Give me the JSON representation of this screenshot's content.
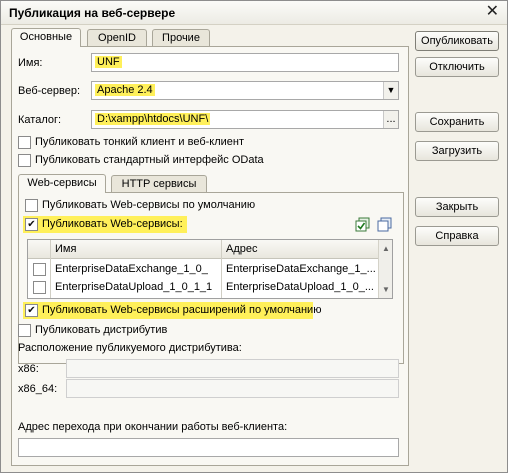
{
  "window": {
    "title": "Публикация на веб-сервере",
    "close_glyph": "✕"
  },
  "tabs": [
    {
      "label": "Основные"
    },
    {
      "label": "OpenID"
    },
    {
      "label": "Прочие"
    }
  ],
  "form": {
    "name_label": "Имя:",
    "name_value": "UNF",
    "webserver_label": "Веб-сервер:",
    "webserver_value": "Apache 2.4",
    "catalog_label": "Каталог:",
    "catalog_value": "D:\\xampp\\htdocs\\UNF\\",
    "catalog_button": "...",
    "publish_thin_client": "Публиковать тонкий клиент и веб-клиент",
    "publish_odata": "Публиковать стандартный интерфейс OData"
  },
  "inner_tabs": [
    {
      "label": "Web-сервисы"
    },
    {
      "label": "HTTP сервисы"
    }
  ],
  "webservices": {
    "publish_default": "Публиковать Web-сервисы по умолчанию",
    "publish_ws": "Публиковать Web-сервисы:",
    "columns": [
      "Имя",
      "Адрес"
    ],
    "rows": [
      {
        "name": "EnterpriseDataExchange_1_0_",
        "address": "EnterpriseDataExchange_1_..."
      },
      {
        "name": "EnterpriseDataUpload_1_0_1_1",
        "address": "EnterpriseDataUpload_1_0_..."
      }
    ],
    "publish_extensions": "Публиковать Web-сервисы расширений по умолчанию"
  },
  "distrib": {
    "publish_distrib": "Публиковать дистрибутив",
    "location_label": "Расположение публикуемого дистрибутива:",
    "x86_label": "x86:",
    "x86_64_label": "x86_64:",
    "x86_value": "",
    "x86_64_value": ""
  },
  "redirect": {
    "label": "Адрес перехода при окончании работы веб-клиента:",
    "value": ""
  },
  "buttons": {
    "publish": "Опубликовать",
    "disconnect": "Отключить",
    "save": "Сохранить",
    "load": "Загрузить",
    "close": "Закрыть",
    "help": "Справка"
  },
  "colors": {
    "highlight": "#fff05a",
    "window_bg": "#f4f2ea"
  },
  "icons": [
    "check-all-icon",
    "uncheck-all-icon",
    "dropdown-arrow-icon"
  ]
}
